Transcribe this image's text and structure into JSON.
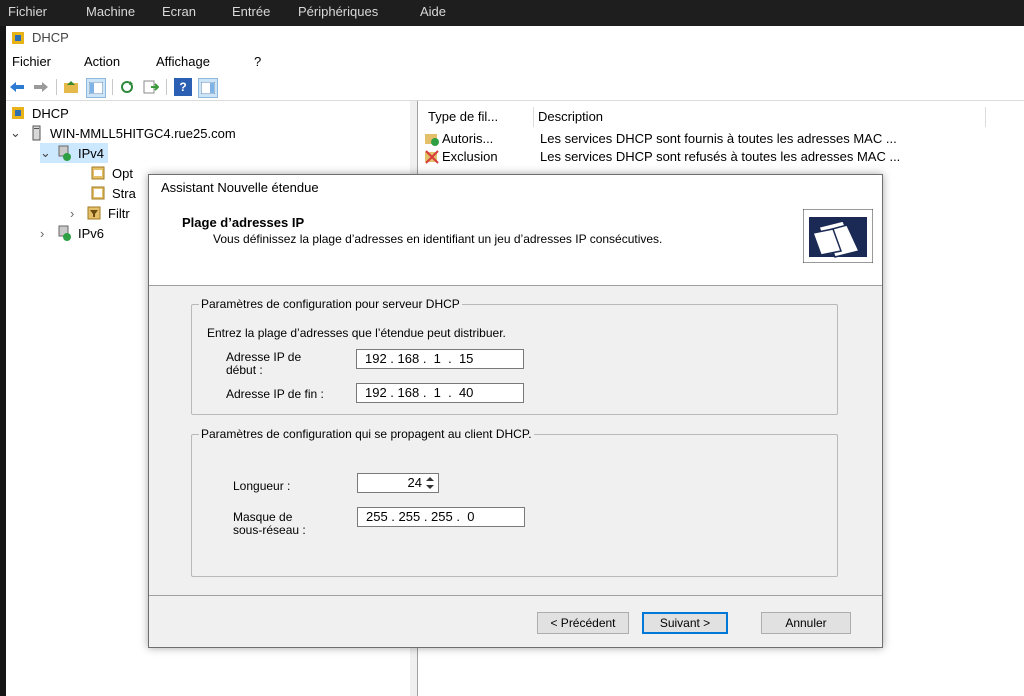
{
  "vm_menu": [
    "Fichier",
    "Machine",
    "Ecran",
    "Entrée",
    "Périphériques",
    "Aide"
  ],
  "window": {
    "title": "DHCP"
  },
  "menu": [
    "Fichier",
    "Action",
    "Affichage",
    "?"
  ],
  "toolbar": [
    "back-icon",
    "forward-icon",
    "up-folder-icon",
    "show-tree-icon",
    "refresh-icon",
    "export-icon",
    "help-icon",
    "properties-icon"
  ],
  "tree": {
    "root": "DHCP",
    "server": "WIN-MMLL5HITGC4.rue25.com",
    "ipv4": "IPv4",
    "children": [
      "Opt",
      "Stra",
      "Filtr"
    ],
    "ipv6": "IPv6"
  },
  "detail": {
    "headers": [
      "Type de fil...",
      "Description"
    ],
    "rows": [
      {
        "type": "Autoris...",
        "desc": "Les services DHCP sont fournis à toutes les adresses MAC ..."
      },
      {
        "type": "Exclusion",
        "desc": "Les services DHCP sont refusés à toutes les adresses MAC ..."
      }
    ]
  },
  "wizard": {
    "title": "Assistant Nouvelle étendue",
    "heading": "Plage d’adresses IP",
    "subheading": "Vous définissez la plage d’adresses en identifiant un jeu d’adresses IP consécutives.",
    "group1": {
      "legend": "Paramètres de configuration pour serveur DHCP",
      "intro": "Entrez la plage d’adresses que l’étendue peut distribuer.",
      "start_label_1": "Adresse IP de",
      "start_label_2": "début :",
      "start_value": "192 . 168 .  1  .  15",
      "end_label": "Adresse IP de fin :",
      "end_value": "192 . 168 .  1  .  40"
    },
    "group2": {
      "legend": "Paramètres de configuration qui se propagent au client DHCP.",
      "length_label": "Longueur :",
      "length_value": "24",
      "mask_label_1": "Masque de",
      "mask_label_2": "sous-réseau :",
      "mask_value": "255 . 255 . 255 .  0"
    },
    "buttons": {
      "back": "< Précédent",
      "next": "Suivant >",
      "cancel": "Annuler"
    }
  }
}
